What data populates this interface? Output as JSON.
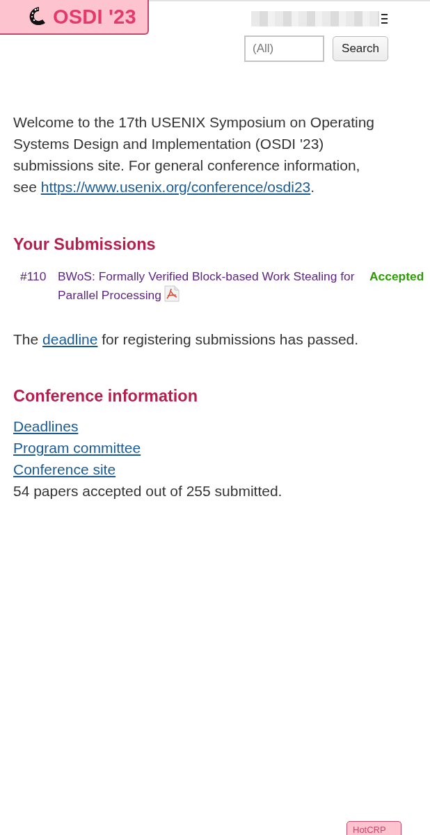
{
  "header": {
    "logo": {
      "title": "OSDI '23"
    },
    "search": {
      "placeholder": "(All)",
      "button": "Search"
    }
  },
  "welcome": {
    "text": "Welcome to the 17th USENIX Symposium on Operating Systems Design and Implementation (OSDI '23) submissions site. For general conference information, see ",
    "link": "https://www.usenix.org/conference/osdi23",
    "text_after": "."
  },
  "submissions": {
    "title": "Your Submissions",
    "items": [
      {
        "number": "#110",
        "title": "BWoS: Formally Verified Block-based Work Stealing for Parallel Processing",
        "status": "Accepted"
      }
    ]
  },
  "deadline_notice": {
    "text": "The ",
    "link": "deadline",
    "text_after": " for registering submissions has passed."
  },
  "conference_info": {
    "title": "Conference information",
    "links": [
      "Deadlines",
      "Program committee",
      "Conference site"
    ],
    "summary": "54 papers accepted out of 255 submitted."
  },
  "footer": {
    "badge": "HotCRP"
  }
}
